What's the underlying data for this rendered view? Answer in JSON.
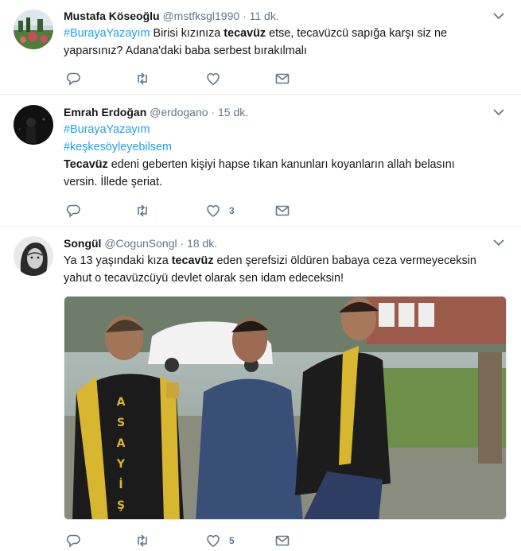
{
  "tweets": [
    {
      "name": "Mustafa Köseoğlu",
      "handle": "@mstfksgl1990",
      "sep": "·",
      "time": "11 dk.",
      "line1": {
        "hashtag": "#BurayaYazayım",
        "pre": " Birisi kızınıza ",
        "kw": "tecavüz",
        "post": " etse, tecavüzcü sapığa karşı siz ne"
      },
      "line2": "yaparsınız? Adana'daki baba serbest bırakılmalı",
      "likes": ""
    },
    {
      "name": "Emrah Erdoğan",
      "handle": "@erdogano",
      "sep": "·",
      "time": "15 dk.",
      "hashtag1": "#BurayaYazayım",
      "hashtag2": "#keşkesöyleyebilsem",
      "line1": {
        "kw": "Tecavüz",
        "post": " edeni geberten kişiyi hapse tıkan kanunları koyanların allah belasını"
      },
      "line2": "versin. İllede şeriat.",
      "likes": "3"
    },
    {
      "name": "Songül",
      "handle": "@CogunSongl",
      "sep": "·",
      "time": "18 dk.",
      "line1": {
        "pre": "Ya 13 yaşındaki kıza ",
        "kw": "tecavüz",
        "post": " eden şerefsizi öldüren babaya ceza vermeyeceksin"
      },
      "line2": "yahut o tecavüzcüyü devlet olarak sen idam edeceksin!",
      "photo_text": "ASAYİŞ",
      "likes": "5"
    }
  ],
  "colors": {
    "link": "#1da1f2",
    "meta": "#657786",
    "text": "#14171a",
    "divider": "#e6ecf0"
  }
}
